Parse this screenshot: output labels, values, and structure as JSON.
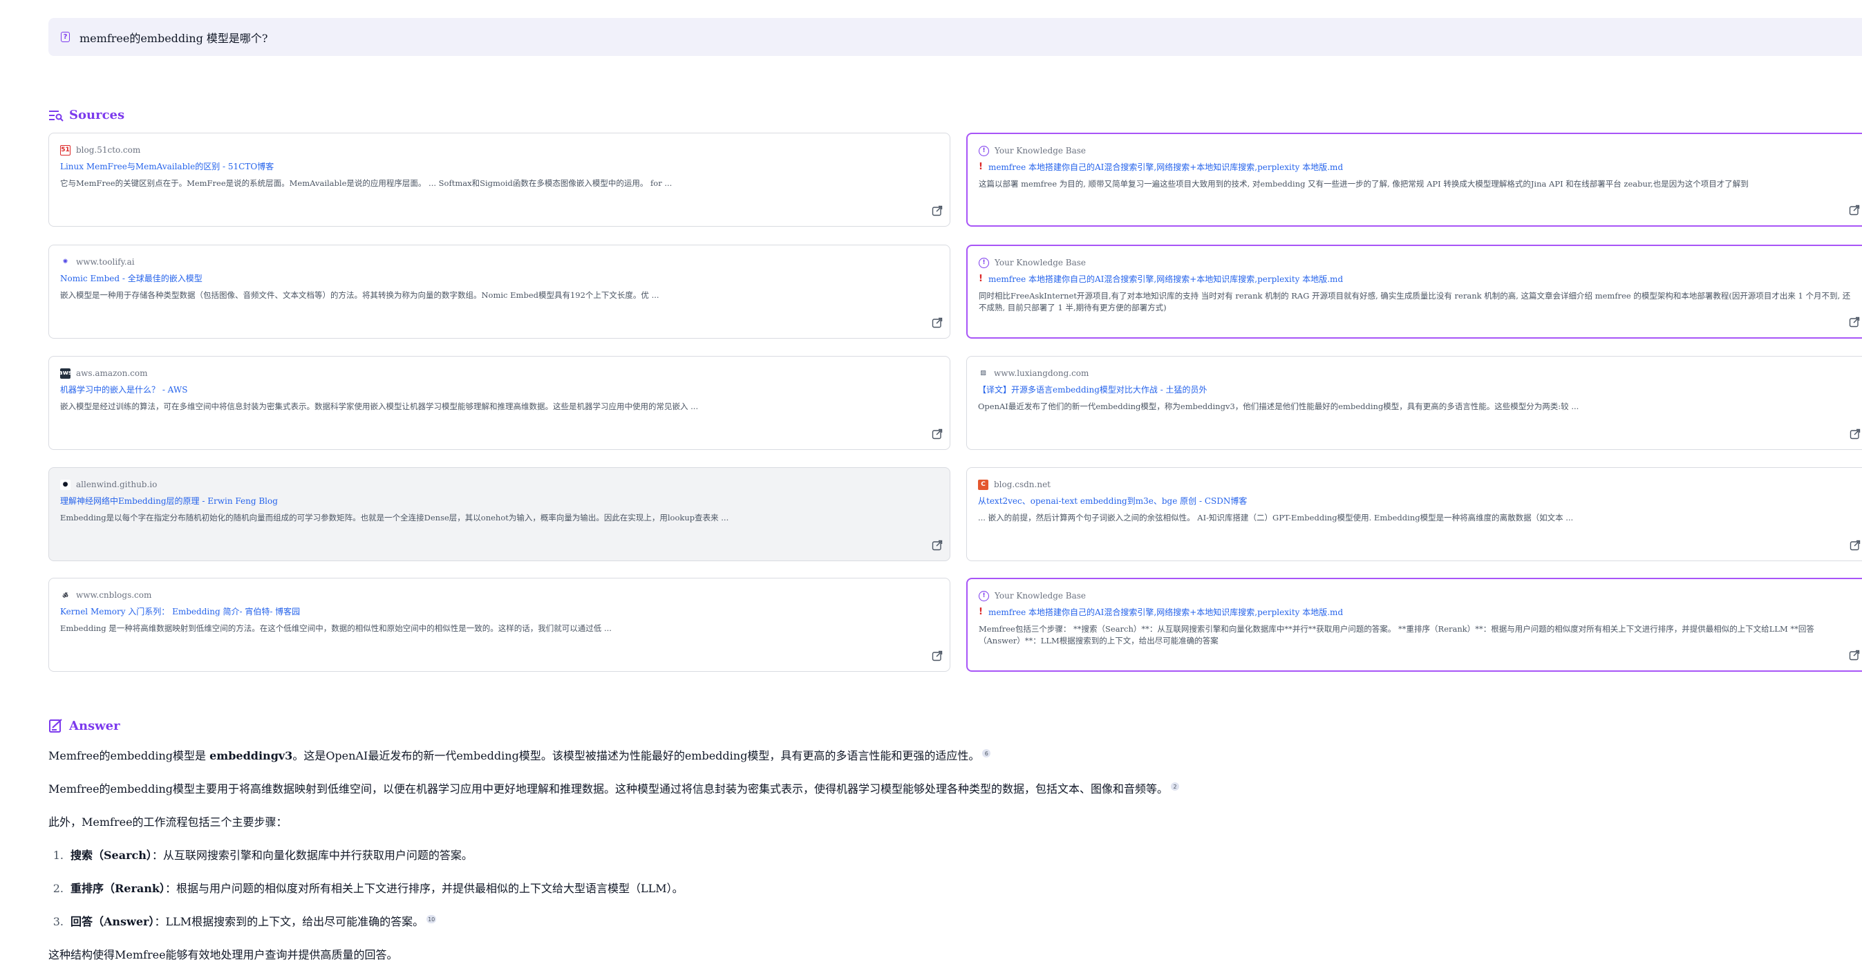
{
  "question": "memfree的embedding 模型是哪个?",
  "sources_heading": "Sources",
  "answer_heading": "Answer",
  "sources": [
    {
      "site": "blog.51cto.com",
      "favicon": "51",
      "fav_bg": "#ffffff",
      "fav_fg": "#dc2626",
      "title": "Linux MemFree与MemAvailable的区别 - 51CTO博客",
      "snippet": "它与MemFree的关键区别点在于。MemFree是说的系统层面。MemAvailable是说的应用程序层面。 ... Softmax和Sigmoid函数在多模态图像嵌入模型中的运用。 for ...",
      "kb": false
    },
    {
      "site": "Your Knowledge Base",
      "favicon": "!",
      "fav_bg": "#ffffff",
      "fav_fg": "#7c3aed",
      "title": "memfree 本地搭建你自己的AI混合搜索引擎,网络搜索+本地知识库搜索,perplexity 本地版.md",
      "snippet": "这篇以部署 memfree 为目的, 顺带又简单复习一遍这些项目大致用到的技术, 对embedding 又有一些进一步的了解, 像把常规 API 转换成大模型理解格式的Jina API 和在线部署平台 zeabur,也是因为这个项目才了解到",
      "kb": true
    },
    {
      "site": "www.toolify.ai",
      "favicon": "✺",
      "fav_bg": "#ffffff",
      "fav_fg": "#4f46e5",
      "title": "Nomic Embed - 全球最佳的嵌入模型",
      "snippet": "嵌入模型是一种用于存储各种类型数据（包括图像、音频文件、文本文档等）的方法。将其转换为称为向量的数字数组。Nomic Embed模型具有192个上下文长度。优 ...",
      "kb": false
    },
    {
      "site": "Your Knowledge Base",
      "favicon": "!",
      "fav_bg": "#ffffff",
      "fav_fg": "#7c3aed",
      "title": "memfree 本地搭建你自己的AI混合搜索引擎,网络搜索+本地知识库搜索,perplexity 本地版.md",
      "snippet": "同时相比FreeAskInternet开源项目,有了对本地知识库的支持 当时对有 rerank 机制的 RAG 开源项目就有好感, 确实生成质量比没有 rerank 机制的高, 这篇文章会详细介绍 memfree 的模型架构和本地部署教程(因开源项目才出来 1 个月不到, 还不成熟, 目前只部署了 1 半,期待有更方便的部署方式)",
      "kb": true
    },
    {
      "site": "aws.amazon.com",
      "favicon": "aws",
      "fav_bg": "#232f3e",
      "fav_fg": "#ffffff",
      "title": "机器学习中的嵌入是什么？ - AWS",
      "snippet": "嵌入模型是经过训练的算法，可在多维空间中将信息封装为密集式表示。数据科学家使用嵌入模型让机器学习模型能够理解和推理高维数据。这些是机器学习应用中使用的常见嵌入 ...",
      "kb": false
    },
    {
      "site": "www.luxiangdong.com",
      "favicon": "▨",
      "fav_bg": "#ffffff",
      "fav_fg": "#475569",
      "title": "【译文】开源多语言embedding模型对比大作战 - 土猛的员外",
      "snippet": "OpenAI最近发布了他们的新一代embedding模型，称为embeddingv3，他们描述是他们性能最好的embedding模型，具有更高的多语言性能。这些模型分为两类:较 ...",
      "kb": false
    },
    {
      "site": "allenwind.github.io",
      "favicon": "●",
      "fav_bg": "#ffffff",
      "fav_fg": "#111827",
      "title": "理解神经网络中Embedding层的原理 - Erwin Feng Blog",
      "snippet": "Embedding是以每个字在指定分布随机初始化的随机向量而组成的可学习参数矩阵。也就是一个全连接Dense层，其以onehot为输入，概率向量为输出。因此在实现上，用lookup查表来 ...",
      "kb": false
    },
    {
      "site": "blog.csdn.net",
      "favicon": "C",
      "fav_bg": "#e4572e",
      "fav_fg": "#ffffff",
      "title": "从text2vec、openai-text embedding到m3e、bge 原创 - CSDN博客",
      "snippet": "... 嵌入的前提，然后计算两个句子词嵌入之间的余弦相似性。 AI-知识库搭建（二）GPT-Embedding模型使用. Embedding模型是一种将高维度的离散数据（如文本 ...",
      "kb": false
    },
    {
      "site": "www.cnblogs.com",
      "favicon": "ॐ",
      "fav_bg": "#ffffff",
      "fav_fg": "#111827",
      "title": "Kernel Memory 入门系列： Embedding 简介- 宵伯特- 博客园",
      "snippet": "Embedding 是一种将高维数据映射到低维空间的方法。在这个低维空间中，数据的相似性和原始空间中的相似性是一致的。这样的话，我们就可以通过低 ...",
      "kb": false
    },
    {
      "site": "Your Knowledge Base",
      "favicon": "!",
      "fav_bg": "#ffffff",
      "fav_fg": "#7c3aed",
      "title": "memfree 本地搭建你自己的AI混合搜索引擎,网络搜索+本地知识库搜索,perplexity 本地版.md",
      "snippet": "Memfree包括三个步骤： **搜索（Search）**：从互联网搜索引擎和向量化数据库中**并行**获取用户问题的答案。 **重排序（Rerank）**：根据与用户问题的相似度对所有相关上下文进行排序，并提供最相似的上下文给LLM **回答（Answer）**：LLM根据搜索到的上下文，给出尽可能准确的答案",
      "kb": true
    }
  ],
  "answer": {
    "p1_a": "Memfree的embedding模型是 ",
    "p1_bold": "embeddingv3",
    "p1_b": "。这是OpenAI最近发布的新一代embedding模型。该模型被描述为性能最好的embedding模型，具有更高的多语言性能和更强的适应性。",
    "p1_cite": "6",
    "p2": "Memfree的embedding模型主要用于将高维数据映射到低维空间，以便在机器学习应用中更好地理解和推理数据。这种模型通过将信息封装为密集式表示，使得机器学习模型能够处理各种类型的数据，包括文本、图像和音频等。",
    "p2_cite": "2",
    "p3": "此外，Memfree的工作流程包括三个主要步骤：",
    "steps": [
      {
        "num": "1.",
        "bold": "搜索（Search）",
        "text": "：从互联网搜索引擎和向量化数据库中并行获取用户问题的答案。",
        "cite": ""
      },
      {
        "num": "2.",
        "bold": "重排序（Rerank）",
        "text": "：根据与用户问题的相似度对所有相关上下文进行排序，并提供最相似的上下文给大型语言模型（LLM）。",
        "cite": ""
      },
      {
        "num": "3.",
        "bold": "回答（Answer）",
        "text": "：LLM根据搜索到的上下文，给出尽可能准确的答案。",
        "cite": "10"
      }
    ],
    "p4": "这种结构使得Memfree能够有效地处理用户查询并提供高质量的回答。"
  },
  "colors": {
    "accent": "#7c3aed",
    "link": "#2563eb",
    "kb_border": "#a855f7"
  }
}
